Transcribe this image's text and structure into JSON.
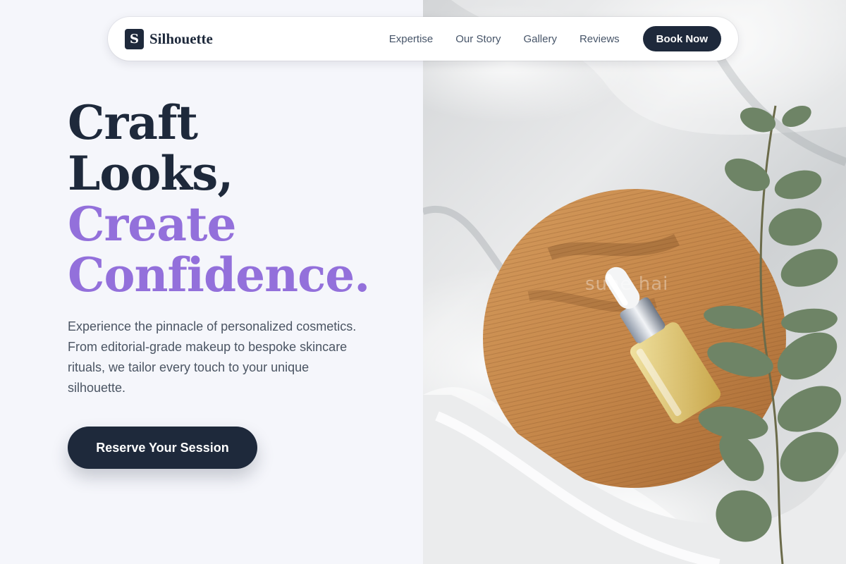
{
  "brand": {
    "mark": "S",
    "name": "Silhouette"
  },
  "nav": {
    "links": [
      "Expertise",
      "Our Story",
      "Gallery",
      "Reviews"
    ],
    "cta": "Book Now"
  },
  "hero": {
    "line1": "Craft",
    "line2": "Looks,",
    "line3": "Create",
    "line4": "Confidence.",
    "description": "Experience the pinnacle of personalized cosmetics. From editorial-grade makeup to bespoke skincare rituals, we tailor every touch to your unique silhouette.",
    "cta": "Reserve Your Session"
  },
  "image": {
    "watermark": "sune hai"
  },
  "colors": {
    "dark": "#1e293b",
    "accent": "#9370db",
    "background": "#f5f6fb"
  }
}
